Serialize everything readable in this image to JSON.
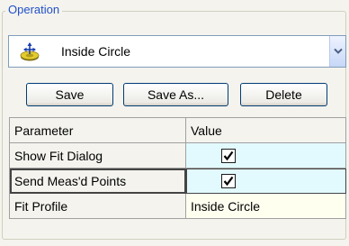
{
  "group": {
    "title": "Operation"
  },
  "combo": {
    "value": "Inside Circle",
    "icon": "inside-circle-icon"
  },
  "buttons": {
    "save": "Save",
    "save_as": "Save As...",
    "delete": "Delete"
  },
  "grid": {
    "headers": [
      "Parameter",
      "Value"
    ],
    "rows": [
      {
        "param": "Show Fit Dialog",
        "checked": true
      },
      {
        "param": "Send Meas'd Points",
        "checked": true,
        "selected": true
      },
      {
        "param": "Fit Profile",
        "value": "Inside Circle"
      }
    ]
  },
  "colors": {
    "accent": "#2150c8",
    "check_cell": "#e2fafe",
    "text_cell": "#fffff0"
  }
}
